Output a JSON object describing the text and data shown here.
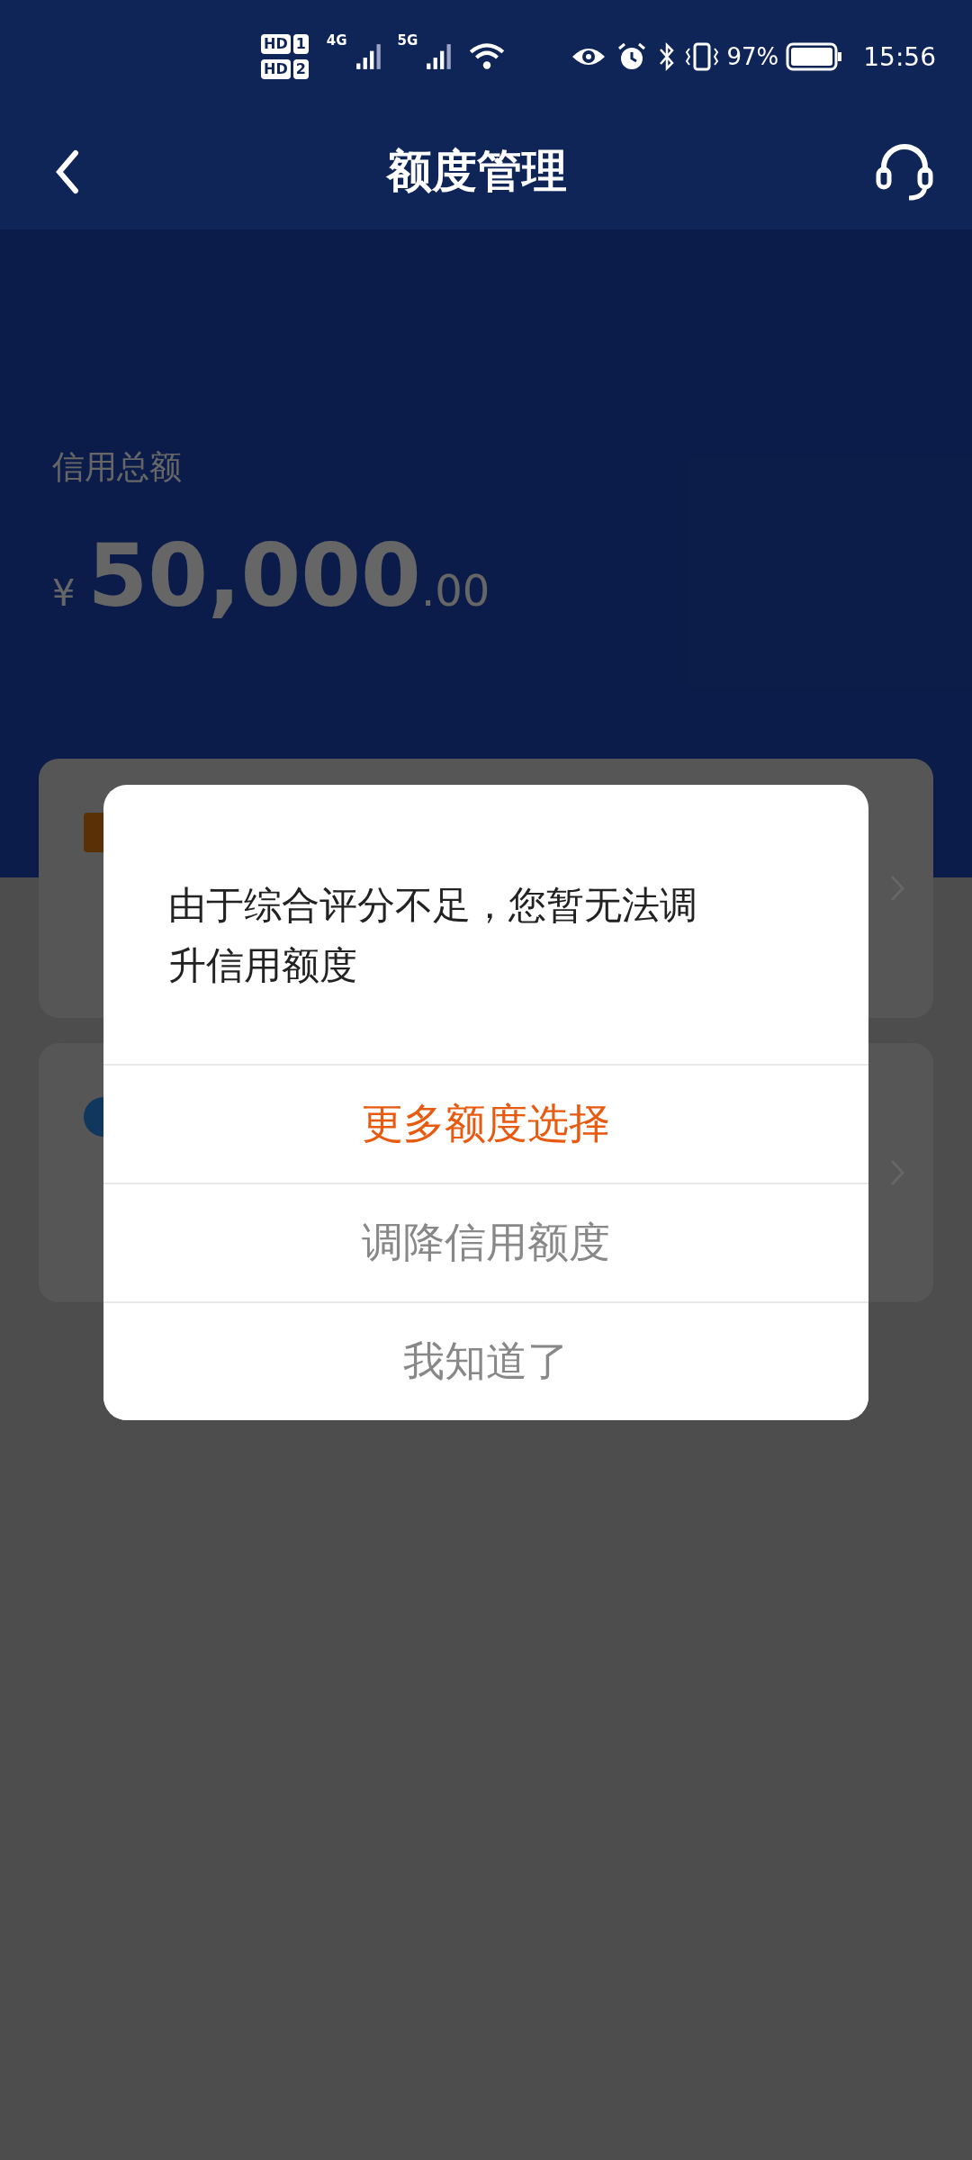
{
  "status_bar": {
    "sims": [
      {
        "label": "HD",
        "slot": "1"
      },
      {
        "label": "HD",
        "slot": "2"
      }
    ],
    "networks": [
      "4G",
      "5G"
    ],
    "battery_percent": "97%",
    "time": "15:56"
  },
  "header": {
    "title": "额度管理"
  },
  "summary": {
    "label": "信用总额",
    "currency": "¥",
    "amount": "50,000",
    "decimals": ".00"
  },
  "cards": [
    {
      "kind": "orange"
    },
    {
      "kind": "blue"
    }
  ],
  "dialog": {
    "message": "由于综合评分不足，您暂无法调升信用额度",
    "actions": [
      {
        "label": "更多额度选择",
        "kind": "primary"
      },
      {
        "label": "调降信用额度",
        "kind": "normal"
      },
      {
        "label": "我知道了",
        "kind": "normal"
      }
    ]
  }
}
